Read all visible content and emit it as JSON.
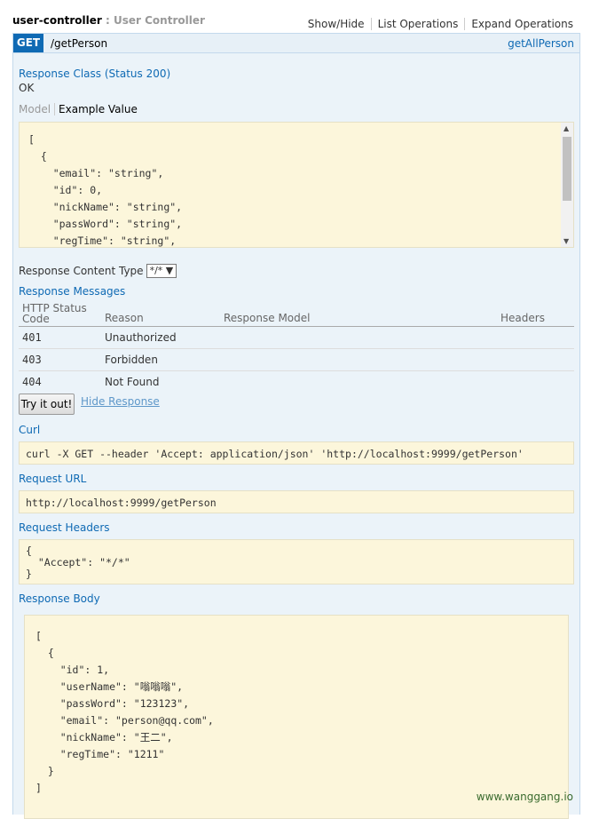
{
  "header": {
    "controller": "user-controller",
    "separator": ":",
    "description": "User Controller",
    "links": [
      "Show/Hide",
      "List Operations",
      "Expand Operations"
    ]
  },
  "operation": {
    "method": "GET",
    "path": "/getPerson",
    "operation_id": "getAllPerson"
  },
  "response_class": {
    "label": "Response Class (Status 200)",
    "value": "OK"
  },
  "model_tabs": {
    "model": "Model",
    "example": "Example Value"
  },
  "example_value": "[\n  {\n    \"email\": \"string\",\n    \"id\": 0,\n    \"nickName\": \"string\",\n    \"passWord\": \"string\",\n    \"regTime\": \"string\",",
  "content_type": {
    "label": "Response Content Type",
    "selected": "*/*"
  },
  "response_messages": {
    "label": "Response Messages",
    "headers": [
      "HTTP Status Code",
      "Reason",
      "Response Model",
      "Headers"
    ],
    "rows": [
      {
        "code": "401",
        "reason": "Unauthorized"
      },
      {
        "code": "403",
        "reason": "Forbidden"
      },
      {
        "code": "404",
        "reason": "Not Found"
      }
    ]
  },
  "buttons": {
    "try_it_out": "Try it out!",
    "hide_response": "Hide Response"
  },
  "curl": {
    "label": "Curl",
    "value": "curl -X GET --header 'Accept: application/json' 'http://localhost:9999/getPerson'"
  },
  "request_url": {
    "label": "Request URL",
    "value": "http://localhost:9999/getPerson"
  },
  "request_headers": {
    "label": "Request Headers",
    "lines": [
      "{",
      "  \"Accept\": \"*/*\"",
      "}"
    ]
  },
  "response_body": {
    "label": "Response Body",
    "value": "[\n  {\n    \"id\": 1,\n    \"userName\": \"嗡嗡嗡\",\n    \"passWord\": \"123123\",\n    \"email\": \"person@qq.com\",\n    \"nickName\": \"王二\",\n    \"regTime\": \"1211\"\n  }\n]"
  },
  "watermark": "www.wanggang.io",
  "colors": {
    "method_get": "#0f6ab4",
    "panel_bg": "#ebf3f9",
    "code_bg": "#fcf6db",
    "link_blue": "#0f6ab4"
  }
}
